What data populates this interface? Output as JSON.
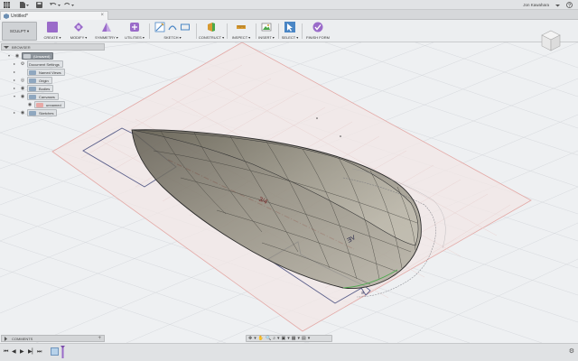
{
  "titlebar": {
    "grid_icon": "grid-apps-icon",
    "file_icon": "file-icon",
    "save_icon": "save-icon",
    "undo_icon": "undo-icon",
    "redo_icon": "redo-icon",
    "user_name": "Jon Kawahara"
  },
  "document_tab": {
    "title": "Untitled*",
    "icon": "model-icon",
    "close_label": "×"
  },
  "workspace": {
    "label": "SCULPT ▾"
  },
  "ribbon": {
    "groups": [
      {
        "label": "CREATE ▾"
      },
      {
        "label": "MODIFY ▾"
      },
      {
        "label": "SYMMETRY ▾"
      },
      {
        "label": "UTILITIES ▾"
      },
      {
        "label": "SKETCH ▾"
      },
      {
        "label": "CONSTRUCT ▾"
      },
      {
        "label": "INSPECT ▾"
      },
      {
        "label": "INSERT ▾"
      },
      {
        "label": "SELECT ▾"
      },
      {
        "label": "FINISH FORM"
      }
    ],
    "colors": {
      "purple": "#9a6bc9",
      "blue": "#4a86c5",
      "green": "#4aa84a",
      "orange": "#d79a32",
      "red": "#c94a3a"
    }
  },
  "browser": {
    "title": "BROWSER",
    "nodes": [
      {
        "label": "(Unsaved)",
        "expander": "▾"
      },
      {
        "label": "Document Settings",
        "expander": "▸"
      },
      {
        "label": "Named Views",
        "expander": "▸"
      },
      {
        "label": "Origin",
        "expander": "▸"
      },
      {
        "label": "Bodies",
        "expander": "▸"
      },
      {
        "label": "Canvases",
        "expander": "▾"
      },
      {
        "label": "unnamed",
        "expander": ""
      },
      {
        "label": "Sketches",
        "expander": "▸"
      }
    ]
  },
  "viewport": {
    "canvas_label": "3/4",
    "canvas_label_alt": "ƎV",
    "canvas_label_small": "ə"
  },
  "comments": {
    "label": "COMMENTS"
  },
  "navbar": {
    "items": [
      "✥",
      "▾",
      "✋",
      "🔍",
      "⌕",
      "▾",
      "▣",
      "▾",
      "▦",
      "▾",
      "▤",
      "▾"
    ]
  },
  "timeline": {
    "first_label": "⏮",
    "prev_label": "◀",
    "play_label": "▶",
    "next_label": "▶▏",
    "last_label": "⏭",
    "settings_icon": "gear-icon",
    "settings_label": "⚙"
  }
}
